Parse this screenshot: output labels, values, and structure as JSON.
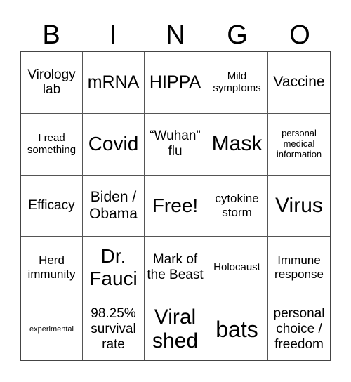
{
  "header": [
    "B",
    "I",
    "N",
    "G",
    "O"
  ],
  "cells": [
    "Virology lab",
    "mRNA",
    "HIPPA",
    "Mild symptoms",
    "Vaccine",
    "I read something",
    "Covid",
    "“Wuhan” flu",
    "Mask",
    "personal medical information",
    "Efficacy",
    "Biden / Obama",
    "Free!",
    "cytokine storm",
    "Virus",
    "Herd immunity",
    "Dr. Fauci",
    "Mark of the Beast",
    "Holocaust",
    "Immune response",
    "experimental",
    "98.25% survival rate",
    "Viral shed",
    "bats",
    "personal choice / freedom"
  ]
}
